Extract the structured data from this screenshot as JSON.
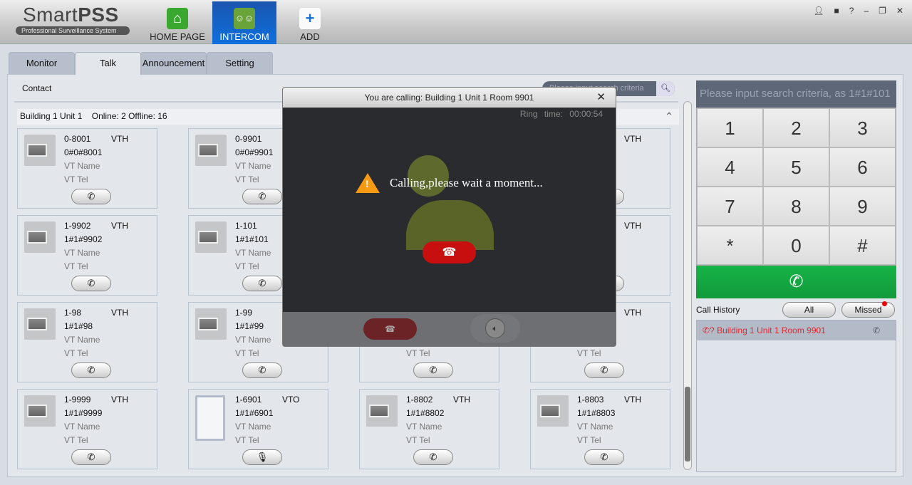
{
  "app": {
    "logo_main": "Smart",
    "logo_bold": "PSS",
    "logo_sub": "Professional Surveillance System"
  },
  "nav": [
    {
      "label": "HOME PAGE",
      "icon": "home-icon"
    },
    {
      "label": "INTERCOM",
      "icon": "intercom-icon",
      "active": true
    },
    {
      "label": "ADD",
      "icon": "plus-icon"
    }
  ],
  "window_controls": [
    "user-icon",
    "lock-icon",
    "help-icon",
    "minimize-icon",
    "restore-icon",
    "close-icon"
  ],
  "tabs": [
    {
      "label": "Monitor"
    },
    {
      "label": "Talk",
      "active": true
    },
    {
      "label": "Announcement"
    },
    {
      "label": "Setting"
    }
  ],
  "contact": {
    "title": "Contact",
    "search_placeholder": "Please input search criteria"
  },
  "group": {
    "name": "Building 1 Unit 1",
    "status": "Online: 2 Offline: 16"
  },
  "cards": [
    {
      "id": "0-8001",
      "type": "VTH",
      "address": "0#0#8001",
      "name": "VT Name",
      "tel": "VT Tel",
      "action": "call"
    },
    {
      "id": "0-9901",
      "type": "",
      "address": "0#0#9901",
      "name": "VT Name",
      "tel": "VT Tel",
      "action": "call"
    },
    {
      "id": "",
      "type": "",
      "address": "",
      "name": "",
      "tel": "",
      "action": "call"
    },
    {
      "id": "",
      "type": "VTH",
      "address": "",
      "name": "",
      "tel": "",
      "action": "call"
    },
    {
      "id": "1-9902",
      "type": "VTH",
      "address": "1#1#9902",
      "name": "VT Name",
      "tel": "VT Tel",
      "action": "call"
    },
    {
      "id": "1-101",
      "type": "",
      "address": "1#1#101",
      "name": "VT Name",
      "tel": "VT Tel",
      "action": "call"
    },
    {
      "id": "",
      "type": "",
      "address": "",
      "name": "",
      "tel": "",
      "action": "call"
    },
    {
      "id": "",
      "type": "VTH",
      "address": "",
      "name": "",
      "tel": "",
      "action": "call"
    },
    {
      "id": "1-98",
      "type": "VTH",
      "address": "1#1#98",
      "name": "VT Name",
      "tel": "VT Tel",
      "action": "call"
    },
    {
      "id": "1-99",
      "type": "",
      "address": "1#1#99",
      "name": "VT Name",
      "tel": "VT Tel",
      "action": "call"
    },
    {
      "id": "",
      "type": "",
      "address": "",
      "name": "",
      "tel": "VT Tel",
      "action": "call"
    },
    {
      "id": "",
      "type": "VTH",
      "address": "",
      "name": "",
      "tel": "VT Tel",
      "action": "call"
    },
    {
      "id": "1-9999",
      "type": "VTH",
      "address": "1#1#9999",
      "name": "VT Name",
      "tel": "VT Tel",
      "action": "call"
    },
    {
      "id": "1-6901",
      "type": "VTO",
      "address": "1#1#6901",
      "name": "VT Name",
      "tel": "VT Tel",
      "action": "talk"
    },
    {
      "id": "1-8802",
      "type": "VTH",
      "address": "1#1#8802",
      "name": "VT Name",
      "tel": "VT Tel",
      "action": "call"
    },
    {
      "id": "1-8803",
      "type": "VTH",
      "address": "1#1#8803",
      "name": "VT Name",
      "tel": "VT Tel",
      "action": "call"
    }
  ],
  "dialpad": {
    "placeholder": "Please input search criteria, as 1#1#101",
    "keys": [
      "1",
      "2",
      "3",
      "4",
      "5",
      "6",
      "7",
      "8",
      "9",
      "*",
      "0",
      "#"
    ],
    "dial_color": "#14a843"
  },
  "call_history": {
    "title": "Call History",
    "all": "All",
    "missed": "Missed",
    "missed_badge": true,
    "items": [
      {
        "label": "Building 1 Unit 1 Room 9901",
        "status": "missed"
      }
    ]
  },
  "dialog": {
    "title": "You are calling: Building 1 Unit 1 Room 9901",
    "ring_label": "Ring time:",
    "ring_time": "00:00:54",
    "message": "Calling,please wait a moment..."
  }
}
